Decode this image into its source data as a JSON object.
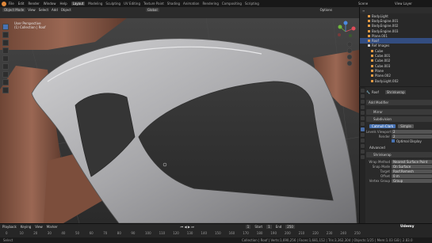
{
  "menubar": {
    "menus": [
      "File",
      "Edit",
      "Render",
      "Window",
      "Help"
    ],
    "workspaces": [
      "Layout",
      "Modeling",
      "Sculpting",
      "UV Editing",
      "Texture Paint",
      "Shading",
      "Animation",
      "Rendering",
      "Compositing",
      "Scripting"
    ],
    "active_workspace": "Layout",
    "scene": "Scene",
    "view_layer": "View Layer"
  },
  "viewport_header": {
    "mode": "Object Mode",
    "menus": [
      "View",
      "Select",
      "Add",
      "Object"
    ],
    "orientation": "Global",
    "shading": "Options"
  },
  "viewport_overlay": {
    "view_name": "User Perspective",
    "collection": "(1) Collection | Roof"
  },
  "outliner": {
    "items": [
      {
        "label": "Body.Light",
        "selected": false
      },
      {
        "label": "Body.Engine.001",
        "selected": false
      },
      {
        "label": "Body.Engine.002",
        "selected": false
      },
      {
        "label": "Body.Engine.003",
        "selected": false
      },
      {
        "label": "Plane.001",
        "selected": false
      },
      {
        "label": "Roof",
        "selected": true
      },
      {
        "label": "Ref Images",
        "selected": false
      },
      {
        "label": "Cube",
        "selected": false
      },
      {
        "label": "Cube.001",
        "selected": false
      },
      {
        "label": "Cube.002",
        "selected": false
      },
      {
        "label": "Cube.003",
        "selected": false
      },
      {
        "label": "Plane",
        "selected": false
      },
      {
        "label": "Plane.002",
        "selected": false
      },
      {
        "label": "Body.Light.002",
        "selected": false
      }
    ]
  },
  "properties": {
    "object_name": "Roof",
    "modifier_target": "Shrinkwrap",
    "add_modifier": "Add Modifier",
    "mirror": "Mirror",
    "subdivision": "Subdivision",
    "subdiv_tabs": [
      "Catmull-Clark",
      "Simple"
    ],
    "levels_viewport_label": "Levels Viewport",
    "levels_viewport": "2",
    "render_label": "Render",
    "render": "2",
    "optimal_display": "Optimal Display",
    "advanced": "Advanced",
    "shrinkwrap": "Shrinkwrap",
    "wrap_method_label": "Wrap Method",
    "wrap_method": "Nearest Surface Point",
    "snap_mode_label": "Snap Mode",
    "snap_mode": "On Surface",
    "target_label": "Target",
    "target": "Roof.Remesh",
    "offset_label": "Offset",
    "offset": "0 m",
    "vertex_group_label": "Vertex Group",
    "vertex_group": "Group"
  },
  "timeline": {
    "menus": [
      "Playback",
      "Keying",
      "View",
      "Marker"
    ],
    "start_label": "Start",
    "start": "1",
    "end_label": "End",
    "end": "250",
    "current_frame": "1",
    "tick_labels": [
      "0",
      "10",
      "20",
      "30",
      "40",
      "50",
      "60",
      "70",
      "80",
      "90",
      "100",
      "110",
      "120",
      "130",
      "140",
      "150",
      "160",
      "170",
      "180",
      "190",
      "200",
      "210",
      "220",
      "230",
      "240",
      "250"
    ]
  },
  "statusbar": {
    "left": "Select",
    "stats": "Collection | Roof | Verts:1,690,256 | Faces:1,681,152 | Tris:3,362,304 | Objects:1/25 | Mem:1.03 GiB | 2.83.0"
  },
  "watermark": "Udemy",
  "colors": {
    "accent": "#4772b3",
    "car_paint": "#b7b7b9",
    "car_body_clay": "#8e5a45",
    "select_orange": "#e0883a"
  }
}
